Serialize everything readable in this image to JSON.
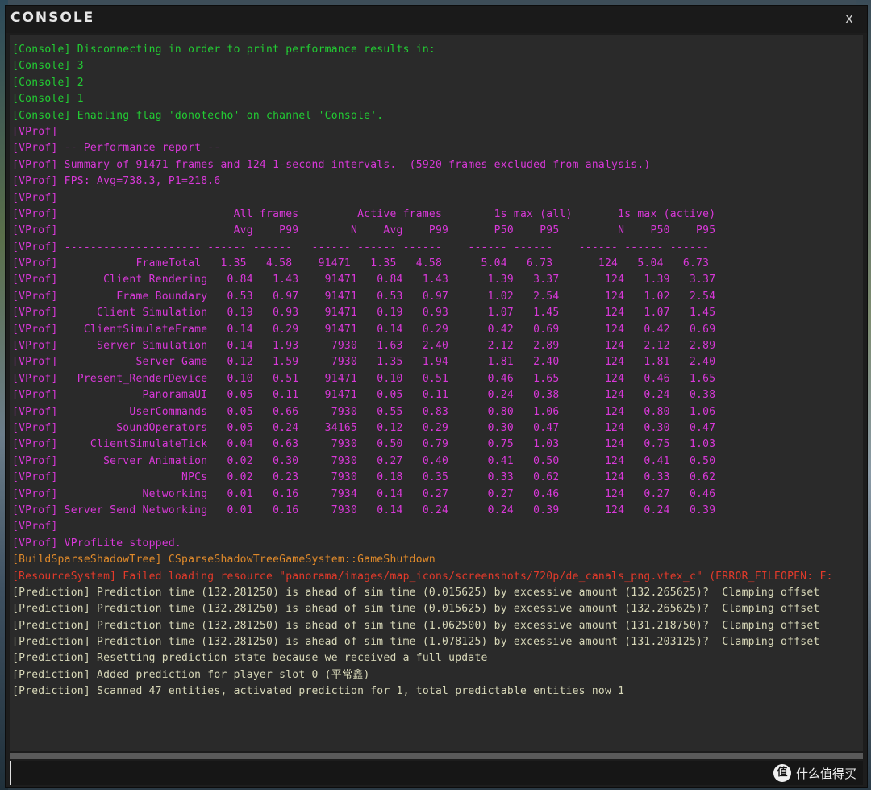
{
  "window": {
    "title": "CONSOLE",
    "close_label": "x"
  },
  "colors": {
    "console": "#22cc33",
    "vprof": "#d838d8",
    "build": "#e08a2a",
    "resource": "#e23a2a",
    "prediction": "#d8d8b8"
  },
  "lines": [
    {
      "text": "[Console] Disconnecting in order to print performance results in:",
      "channel": "console"
    },
    {
      "text": "[Console] 3",
      "channel": "console"
    },
    {
      "text": "[Console] 2",
      "channel": "console"
    },
    {
      "text": "[Console] 1",
      "channel": "console"
    },
    {
      "text": "[Console] Enabling flag 'donotecho' on channel 'Console'.",
      "channel": "console"
    },
    {
      "text": "[VProf]",
      "channel": "vprof"
    },
    {
      "text": "[VProf] -- Performance report --",
      "channel": "vprof"
    },
    {
      "text": "[VProf] Summary of 91471 frames and 124 1-second intervals.  (5920 frames excluded from analysis.)",
      "channel": "vprof"
    },
    {
      "text": "[VProf] FPS: Avg=738.3, P1=218.6",
      "channel": "vprof"
    },
    {
      "text": "[VProf]",
      "channel": "vprof"
    },
    {
      "text": "[VProf]                           All frames         Active frames        1s max (all)       1s max (active)",
      "channel": "vprof"
    },
    {
      "text": "[VProf]                           Avg    P99        N    Avg    P99       P50    P95         N    P50    P95",
      "channel": "vprof"
    },
    {
      "text": "[VProf] --------------------- ------ ------   ------ ------ ------    ------ ------    ------ ------ ------",
      "channel": "vprof"
    },
    {
      "text": "[VProf]            FrameTotal   1.35   4.58    91471   1.35   4.58      5.04   6.73       124   5.04   6.73",
      "channel": "vprof"
    },
    {
      "text": "[VProf]       Client Rendering   0.84   1.43    91471   0.84   1.43      1.39   3.37       124   1.39   3.37",
      "channel": "vprof"
    },
    {
      "text": "[VProf]         Frame Boundary   0.53   0.97    91471   0.53   0.97      1.02   2.54       124   1.02   2.54",
      "channel": "vprof"
    },
    {
      "text": "[VProf]      Client Simulation   0.19   0.93    91471   0.19   0.93      1.07   1.45       124   1.07   1.45",
      "channel": "vprof"
    },
    {
      "text": "[VProf]    ClientSimulateFrame   0.14   0.29    91471   0.14   0.29      0.42   0.69       124   0.42   0.69",
      "channel": "vprof"
    },
    {
      "text": "[VProf]      Server Simulation   0.14   1.93     7930   1.63   2.40      2.12   2.89       124   2.12   2.89",
      "channel": "vprof"
    },
    {
      "text": "[VProf]            Server Game   0.12   1.59     7930   1.35   1.94      1.81   2.40       124   1.81   2.40",
      "channel": "vprof"
    },
    {
      "text": "[VProf]   Present_RenderDevice   0.10   0.51    91471   0.10   0.51      0.46   1.65       124   0.46   1.65",
      "channel": "vprof"
    },
    {
      "text": "[VProf]             PanoramaUI   0.05   0.11    91471   0.05   0.11      0.24   0.38       124   0.24   0.38",
      "channel": "vprof"
    },
    {
      "text": "[VProf]           UserCommands   0.05   0.66     7930   0.55   0.83      0.80   1.06       124   0.80   1.06",
      "channel": "vprof"
    },
    {
      "text": "[VProf]         SoundOperators   0.05   0.24    34165   0.12   0.29      0.30   0.47       124   0.30   0.47",
      "channel": "vprof"
    },
    {
      "text": "[VProf]     ClientSimulateTick   0.04   0.63     7930   0.50   0.79      0.75   1.03       124   0.75   1.03",
      "channel": "vprof"
    },
    {
      "text": "[VProf]       Server Animation   0.02   0.30     7930   0.27   0.40      0.41   0.50       124   0.41   0.50",
      "channel": "vprof"
    },
    {
      "text": "[VProf]                   NPCs   0.02   0.23     7930   0.18   0.35      0.33   0.62       124   0.33   0.62",
      "channel": "vprof"
    },
    {
      "text": "[VProf]             Networking   0.01   0.16     7934   0.14   0.27      0.27   0.46       124   0.27   0.46",
      "channel": "vprof"
    },
    {
      "text": "[VProf] Server Send Networking   0.01   0.16     7930   0.14   0.24      0.24   0.39       124   0.24   0.39",
      "channel": "vprof"
    },
    {
      "text": "[VProf]",
      "channel": "vprof"
    },
    {
      "text": "[VProf] VProfLite stopped.",
      "channel": "vprof"
    },
    {
      "text": "[BuildSparseShadowTree] CSparseShadowTreeGameSystem::GameShutdown",
      "channel": "build"
    },
    {
      "text": "[ResourceSystem] Failed loading resource \"panorama/images/map_icons/screenshots/720p/de_canals_png.vtex_c\" (ERROR_FILEOPEN: F:",
      "channel": "resource"
    },
    {
      "text": "[Prediction] Prediction time (132.281250) is ahead of sim time (0.015625) by excessive amount (132.265625)?  Clamping offset",
      "channel": "prediction"
    },
    {
      "text": "[Prediction] Prediction time (132.281250) is ahead of sim time (0.015625) by excessive amount (132.265625)?  Clamping offset",
      "channel": "prediction"
    },
    {
      "text": "[Prediction] Prediction time (132.281250) is ahead of sim time (1.062500) by excessive amount (131.218750)?  Clamping offset",
      "channel": "prediction"
    },
    {
      "text": "[Prediction] Prediction time (132.281250) is ahead of sim time (1.078125) by excessive amount (131.203125)?  Clamping offset",
      "channel": "prediction"
    },
    {
      "text": "[Prediction] Resetting prediction state because we received a full update",
      "channel": "prediction"
    },
    {
      "text": "[Prediction] Added prediction for player slot 0 (平常鑫)",
      "channel": "prediction"
    },
    {
      "text": "[Prediction] Scanned 47 entities, activated prediction for 1, total predictable entities now 1",
      "channel": "prediction"
    }
  ],
  "input": {
    "value": ""
  },
  "watermark": {
    "logo_text": "值",
    "text": "什么值得买"
  }
}
